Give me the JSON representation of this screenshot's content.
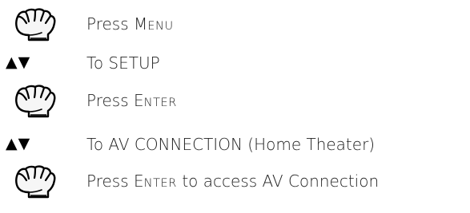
{
  "instructions": {
    "steps": [
      {
        "icon": "press-hand-icon",
        "parts": [
          "Press ",
          "M",
          "ENU",
          ""
        ]
      },
      {
        "icon": "up-down-arrows-icon",
        "arrows": "▲▼",
        "text": "To SETUP"
      },
      {
        "icon": "press-hand-icon",
        "parts": [
          "Press ",
          "E",
          "NTER",
          ""
        ]
      },
      {
        "icon": "up-down-arrows-icon",
        "arrows": "▲▼",
        "text": "To AV CONNECTION (Home Theater)"
      },
      {
        "icon": "press-hand-icon",
        "parts": [
          "Press ",
          "E",
          "NTER",
          " to access AV Connection"
        ]
      }
    ]
  },
  "colors": {
    "text": "#1e1e1e",
    "icon_fill": "#f6f6f6",
    "icon_stroke": "#000000"
  }
}
